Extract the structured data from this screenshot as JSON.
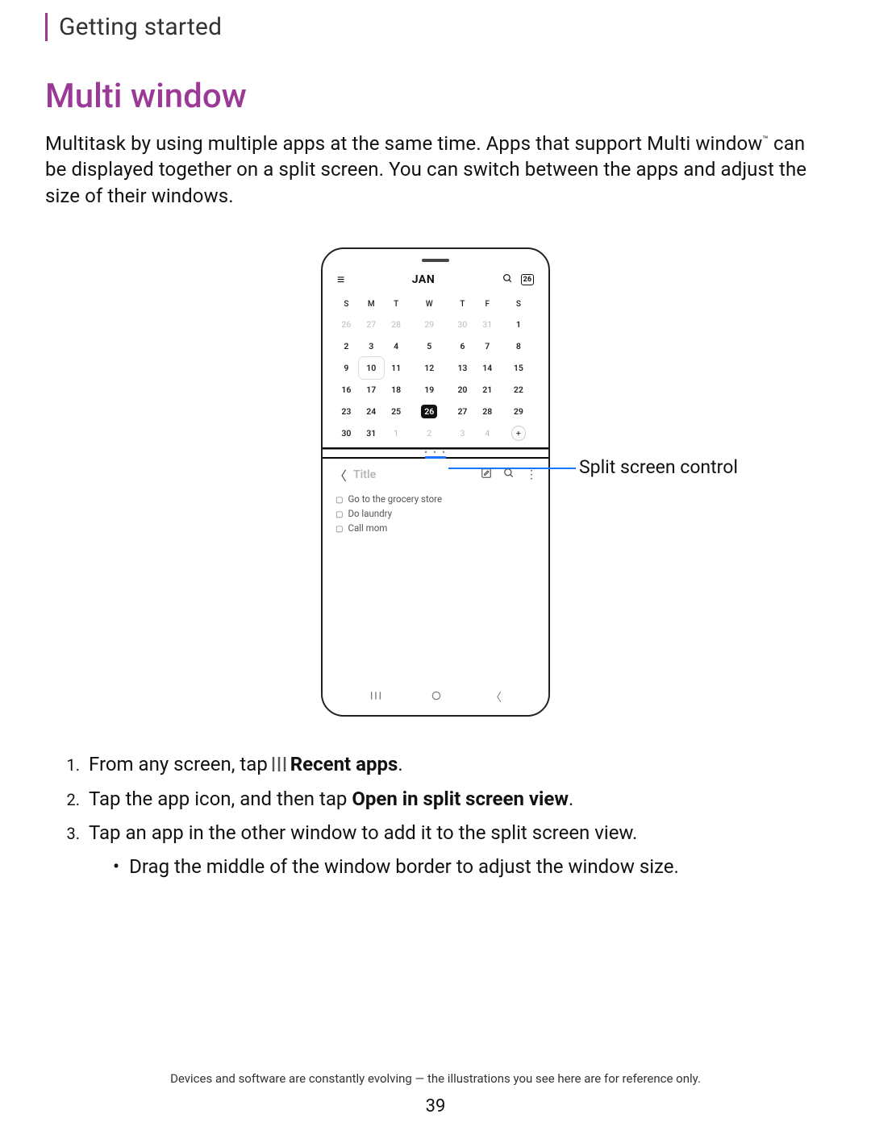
{
  "header": {
    "breadcrumb": "Getting started"
  },
  "title": "Multi window",
  "intro_pre": "Multitask by using multiple apps at the same time. Apps that support Multi window",
  "intro_sup": "™",
  "intro_post": " can be displayed together on a split screen. You can switch between the apps and adjust the size of their windows.",
  "callout": "Split screen control",
  "phone": {
    "calendar": {
      "month": "JAN",
      "today_badge": "26",
      "dow": [
        "S",
        "M",
        "T",
        "W",
        "T",
        "F",
        "S"
      ],
      "rows": [
        {
          "cells": [
            {
              "t": "26",
              "c": "prev"
            },
            {
              "t": "27",
              "c": "prev"
            },
            {
              "t": "28",
              "c": "prev"
            },
            {
              "t": "29",
              "c": "prev"
            },
            {
              "t": "30",
              "c": "prev"
            },
            {
              "t": "31",
              "c": "prev"
            },
            {
              "t": "1"
            }
          ]
        },
        {
          "cells": [
            {
              "t": "2"
            },
            {
              "t": "3"
            },
            {
              "t": "4"
            },
            {
              "t": "5"
            },
            {
              "t": "6"
            },
            {
              "t": "7"
            },
            {
              "t": "8"
            }
          ]
        },
        {
          "cells": [
            {
              "t": "9"
            },
            {
              "t": "10",
              "c": "sel"
            },
            {
              "t": "11"
            },
            {
              "t": "12"
            },
            {
              "t": "13"
            },
            {
              "t": "14"
            },
            {
              "t": "15"
            }
          ]
        },
        {
          "cells": [
            {
              "t": "16"
            },
            {
              "t": "17"
            },
            {
              "t": "18"
            },
            {
              "t": "19"
            },
            {
              "t": "20"
            },
            {
              "t": "21"
            },
            {
              "t": "22"
            }
          ]
        },
        {
          "cells": [
            {
              "t": "23"
            },
            {
              "t": "24"
            },
            {
              "t": "25"
            },
            {
              "t": "26",
              "c": "today"
            },
            {
              "t": "27"
            },
            {
              "t": "28"
            },
            {
              "t": "29"
            }
          ]
        },
        {
          "cells": [
            {
              "t": "30"
            },
            {
              "t": "31"
            },
            {
              "t": "1",
              "c": "next"
            },
            {
              "t": "2",
              "c": "next"
            },
            {
              "t": "3",
              "c": "next"
            },
            {
              "t": "4",
              "c": "next"
            },
            {
              "t": "+",
              "c": "plus-cell"
            }
          ]
        }
      ]
    },
    "notes": {
      "title_placeholder": "Title",
      "items": [
        "Go to the grocery store",
        "Do laundry",
        "Call mom"
      ]
    }
  },
  "steps": {
    "s1_pre": "From any screen, tap",
    "s1_bold": "Recent apps",
    "s1_post": ".",
    "s2_pre": "Tap the app icon, and then tap ",
    "s2_bold": "Open in split screen view",
    "s2_post": ".",
    "s3": "Tap an app in the other window to add it to the split screen view.",
    "s3_sub": "Drag the middle of the window border to adjust the window size."
  },
  "footnote": "Devices and software are constantly evolving — the illustrations you see here are for reference only.",
  "page_number": "39"
}
